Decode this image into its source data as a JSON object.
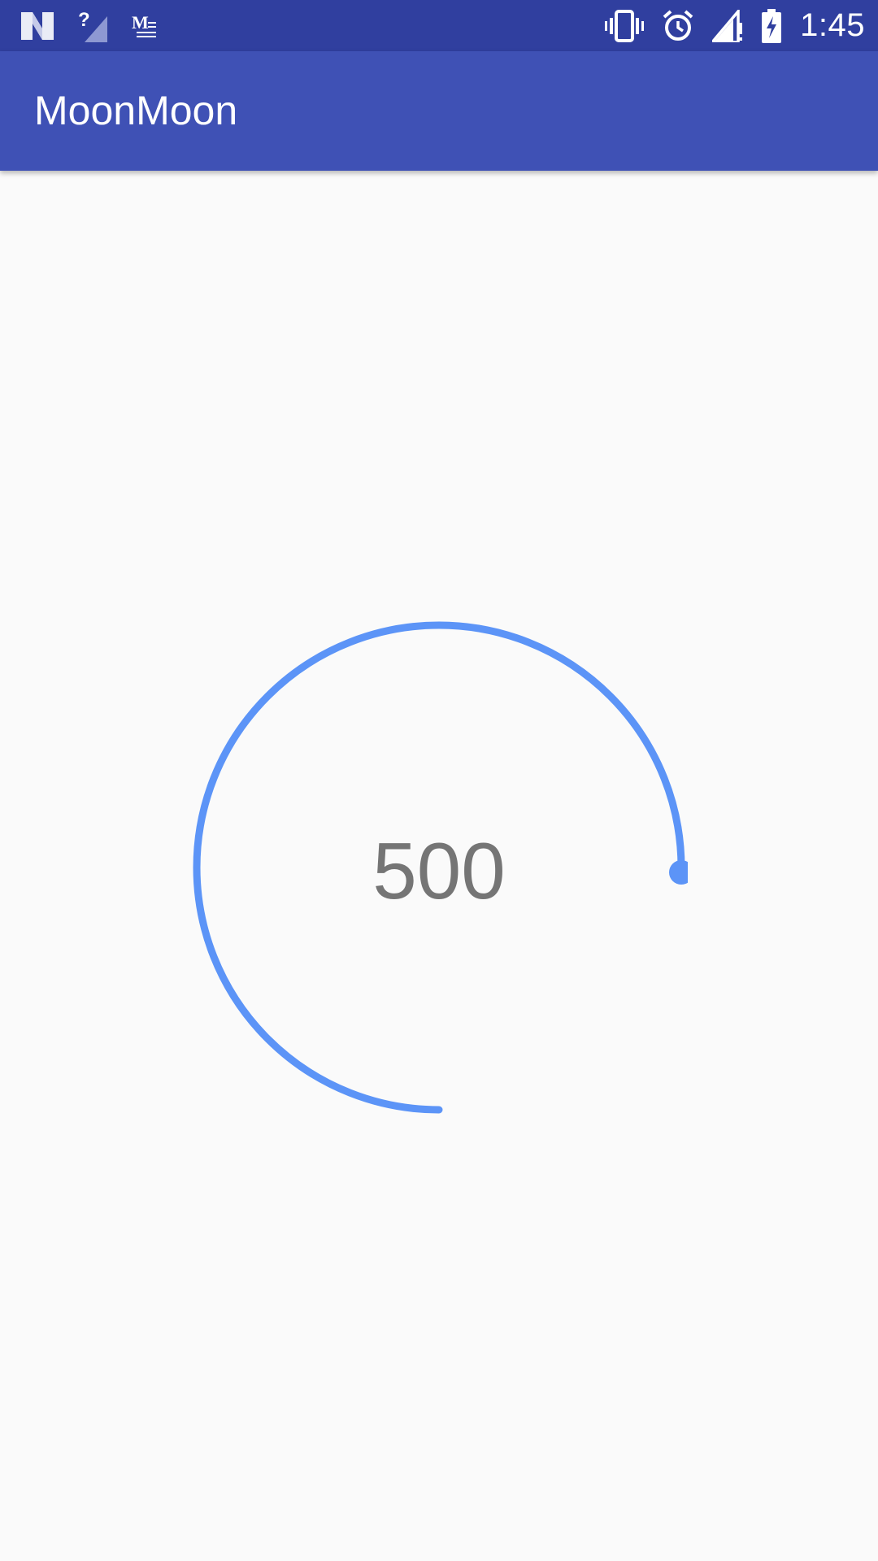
{
  "status_bar": {
    "left_icons": [
      "n-logo-icon",
      "no-signal-question-icon",
      "medium-app-icon"
    ],
    "right_icons": [
      "vibrate-icon",
      "alarm-icon",
      "cell-signal-icon",
      "battery-charging-icon"
    ],
    "time": "1:45"
  },
  "app_bar": {
    "title": "MoonMoon"
  },
  "dial": {
    "value": "500",
    "progress_fraction": 0.75,
    "arc_color": "#5c94f7",
    "text_color": "#757575"
  },
  "colors": {
    "status_bar": "#303f9f",
    "app_bar": "#3f51b5",
    "background": "#fafafa"
  }
}
